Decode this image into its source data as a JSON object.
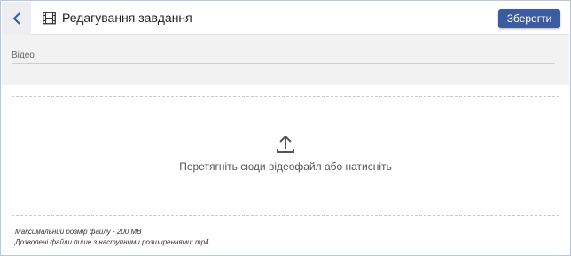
{
  "header": {
    "title": "Редагування завдання",
    "save_label": "Зберегти",
    "back_icon": "chevron-left-icon",
    "title_icon": "film-icon"
  },
  "video_field": {
    "label": "Відео"
  },
  "dropzone": {
    "text": "Перетягніть сюди відеофайл або натисніть",
    "icon": "upload-icon"
  },
  "notes": {
    "max_size": "Максимальний розмір файлу - 200 MB",
    "allowed_ext": "Дозволені файли лише з наступними розширеннями: mp4"
  },
  "colors": {
    "accent": "#3d5ba1",
    "back_arrow": "#3b5a9a"
  }
}
